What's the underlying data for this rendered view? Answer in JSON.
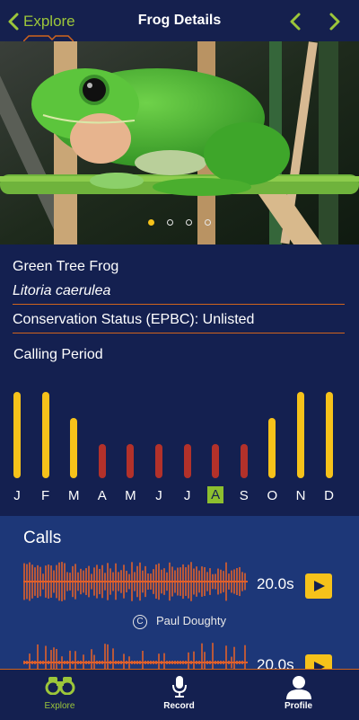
{
  "header": {
    "back_label": "Explore",
    "title": "Frog Details",
    "accent_color": "#9cc63a",
    "divider_color": "#d0641c"
  },
  "photo": {
    "icon": "frog-photo",
    "pages": 4,
    "current_page": 1
  },
  "species": {
    "common_name": "Green Tree Frog",
    "scientific_name": "Litoria caerulea",
    "status": "Conservation Status (EPBC): Unlisted"
  },
  "calling_period": {
    "heading": "Calling Period",
    "current_month": "A",
    "colors": {
      "peak": "#f6c21a",
      "low": "#b3312a"
    }
  },
  "chart_data": {
    "type": "bar",
    "categories": [
      "J",
      "F",
      "M",
      "A",
      "M",
      "J",
      "J",
      "A",
      "S",
      "O",
      "N",
      "D"
    ],
    "values": [
      1.0,
      1.0,
      0.7,
      0.4,
      0.4,
      0.4,
      0.4,
      0.4,
      0.4,
      0.7,
      1.0,
      1.0
    ],
    "levels": [
      "peak",
      "peak",
      "peak",
      "low",
      "low",
      "low",
      "low",
      "low",
      "low",
      "peak",
      "peak",
      "peak"
    ],
    "ylim": [
      0,
      1
    ],
    "grid": false
  },
  "calls": {
    "heading": "Calls",
    "items": [
      {
        "duration": "20.0s",
        "credit": "Paul Doughty",
        "credit_icon": "copyright-icon"
      },
      {
        "duration": "20.0s"
      }
    ]
  },
  "tabs": [
    {
      "label": "Explore",
      "icon": "binoculars-icon",
      "active": true
    },
    {
      "label": "Record",
      "icon": "microphone-icon",
      "active": false
    },
    {
      "label": "Profile",
      "icon": "person-icon",
      "active": false
    }
  ]
}
